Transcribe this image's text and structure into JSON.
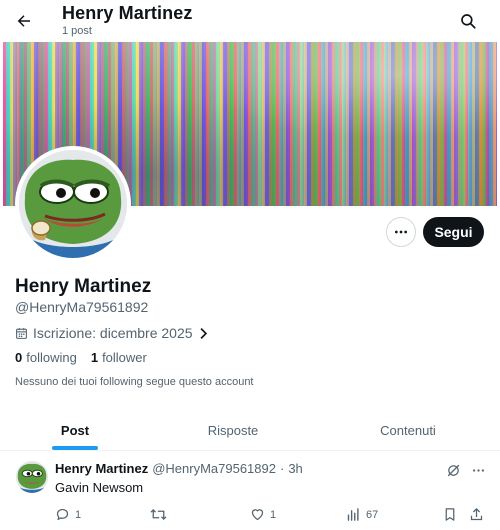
{
  "header": {
    "title": "Henry Martinez",
    "post_count": "1 post",
    "back_icon": "arrow-left-icon",
    "search_icon": "search-icon"
  },
  "profile": {
    "name": "Henry Martinez",
    "handle": "@HenryMa79561892",
    "joined": "Iscrizione: dicembre 2025",
    "following_count": "0",
    "following_label": "following",
    "followers_count": "1",
    "followers_label": "follower",
    "mutual_note": "Nessuno dei tuoi following segue questo account",
    "follow_label": "Segui"
  },
  "tabs": [
    {
      "label": "Post",
      "active": true
    },
    {
      "label": "Risposte",
      "active": false
    },
    {
      "label": "Contenuti",
      "active": false
    }
  ],
  "post": {
    "author": "Henry Martinez",
    "handle": "@HenryMa79561892",
    "separator": "·",
    "time": "3h",
    "text": "Gavin Newsom",
    "replies": "1",
    "reposts": "",
    "likes": "1",
    "views": "67"
  },
  "colors": {
    "accent": "#1d9bf0",
    "text": "#0f1419",
    "muted": "#536471",
    "follow_bg": "#0f1419"
  }
}
